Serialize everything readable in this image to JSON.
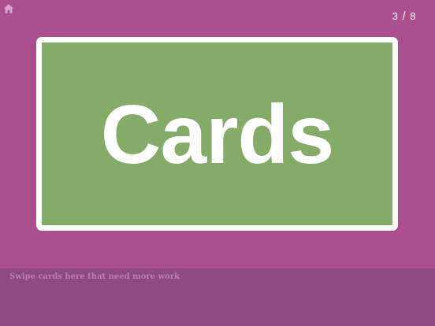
{
  "header": {
    "home_icon": "home-icon",
    "progress": {
      "current": "3",
      "separator": "/",
      "total": "8"
    }
  },
  "card": {
    "word": "Cards"
  },
  "drop_zone": {
    "label": "Swipe cards here that need more work"
  },
  "colors": {
    "background": "#ad4e8f",
    "card_fill": "#84ac68",
    "card_border": "#ffffff",
    "drop_zone": "#8f4983",
    "drop_zone_text": "#b97cae"
  }
}
